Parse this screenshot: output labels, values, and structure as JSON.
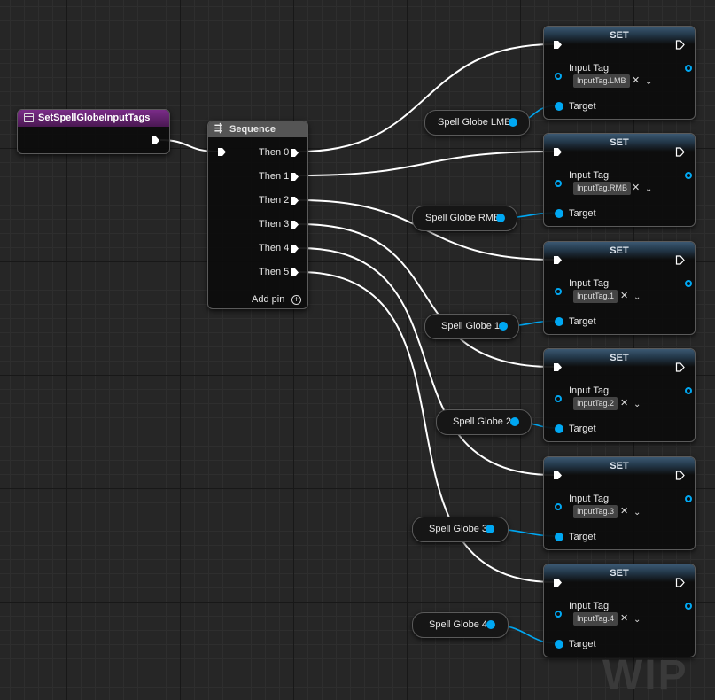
{
  "event_node": {
    "title": "SetSpellGlobeInputTags"
  },
  "sequence_node": {
    "title": "Sequence",
    "outputs": [
      "Then 0",
      "Then 1",
      "Then 2",
      "Then 3",
      "Then 4",
      "Then 5"
    ],
    "add_pin": "Add pin"
  },
  "set_nodes": [
    {
      "title": "SET",
      "input_tag_label": "Input Tag",
      "tag_value": "InputTag.LMB",
      "target_label": "Target"
    },
    {
      "title": "SET",
      "input_tag_label": "Input Tag",
      "tag_value": "InputTag.RMB",
      "target_label": "Target"
    },
    {
      "title": "SET",
      "input_tag_label": "Input Tag",
      "tag_value": "InputTag.1",
      "target_label": "Target"
    },
    {
      "title": "SET",
      "input_tag_label": "Input Tag",
      "tag_value": "InputTag.2",
      "target_label": "Target"
    },
    {
      "title": "SET",
      "input_tag_label": "Input Tag",
      "tag_value": "InputTag.3",
      "target_label": "Target"
    },
    {
      "title": "SET",
      "input_tag_label": "Input Tag",
      "tag_value": "InputTag.4",
      "target_label": "Target"
    }
  ],
  "variables": [
    "Spell Globe LMB",
    "Spell Globe RMB",
    "Spell Globe 1",
    "Spell Globe 2",
    "Spell Globe 3",
    "Spell Globe 4"
  ],
  "watermark": "WIP",
  "colors": {
    "exec_wire": "#ffffff",
    "object_pin": "#00a8f3",
    "set_header": "#3b5872",
    "event_header": "#7a2c88"
  }
}
